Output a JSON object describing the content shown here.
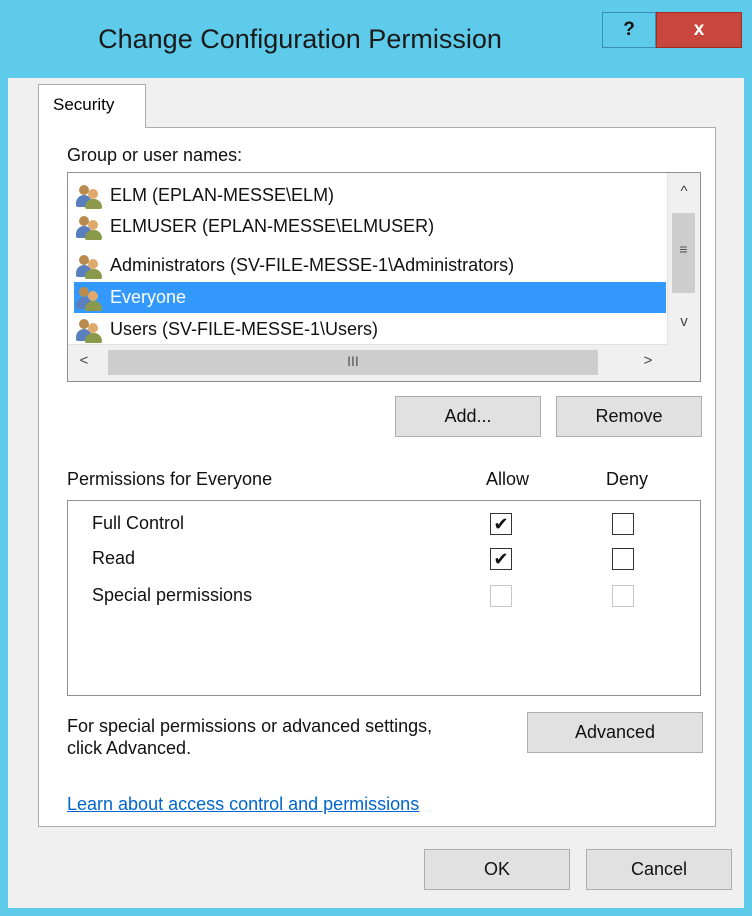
{
  "window": {
    "title": "Change Configuration Permission",
    "help_label": "?",
    "close_label": "x"
  },
  "tabs": [
    {
      "label": "Security"
    }
  ],
  "group": {
    "heading": "Group or user names:",
    "items": [
      {
        "label": "ELM (EPLAN-MESSE\\ELM)",
        "selected": false
      },
      {
        "label": "ELMUSER (EPLAN-MESSE\\ELMUSER)",
        "selected": false
      },
      {
        "label": "Administrators (SV-FILE-MESSE-1\\Administrators)",
        "selected": false
      },
      {
        "label": "Everyone",
        "selected": true
      },
      {
        "label": "Users (SV-FILE-MESSE-1\\Users)",
        "selected": false
      }
    ],
    "scroll": {
      "up": "^",
      "down": "v",
      "left": "<",
      "right": ">",
      "v_grip": "≡",
      "h_grip": "III"
    }
  },
  "buttons": {
    "add": "Add...",
    "remove": "Remove",
    "advanced": "Advanced",
    "ok": "OK",
    "cancel": "Cancel"
  },
  "permissions": {
    "heading": "Permissions for Everyone",
    "allow_header": "Allow",
    "deny_header": "Deny",
    "rows": [
      {
        "label": "Full Control",
        "allow": true,
        "deny": false,
        "enabled": true
      },
      {
        "label": "Read",
        "allow": true,
        "deny": false,
        "enabled": true
      },
      {
        "label": "Special permissions",
        "allow": false,
        "deny": false,
        "enabled": false
      }
    ]
  },
  "advanced_note": {
    "line1": "For special permissions or advanced settings,",
    "line2": "click Advanced."
  },
  "link": "Learn about access control and permissions",
  "check_glyph": "✔",
  "colors": {
    "titlebar": "#5ecbea",
    "close": "#c9463d",
    "selection": "#3399ff",
    "link": "#0066cc"
  }
}
